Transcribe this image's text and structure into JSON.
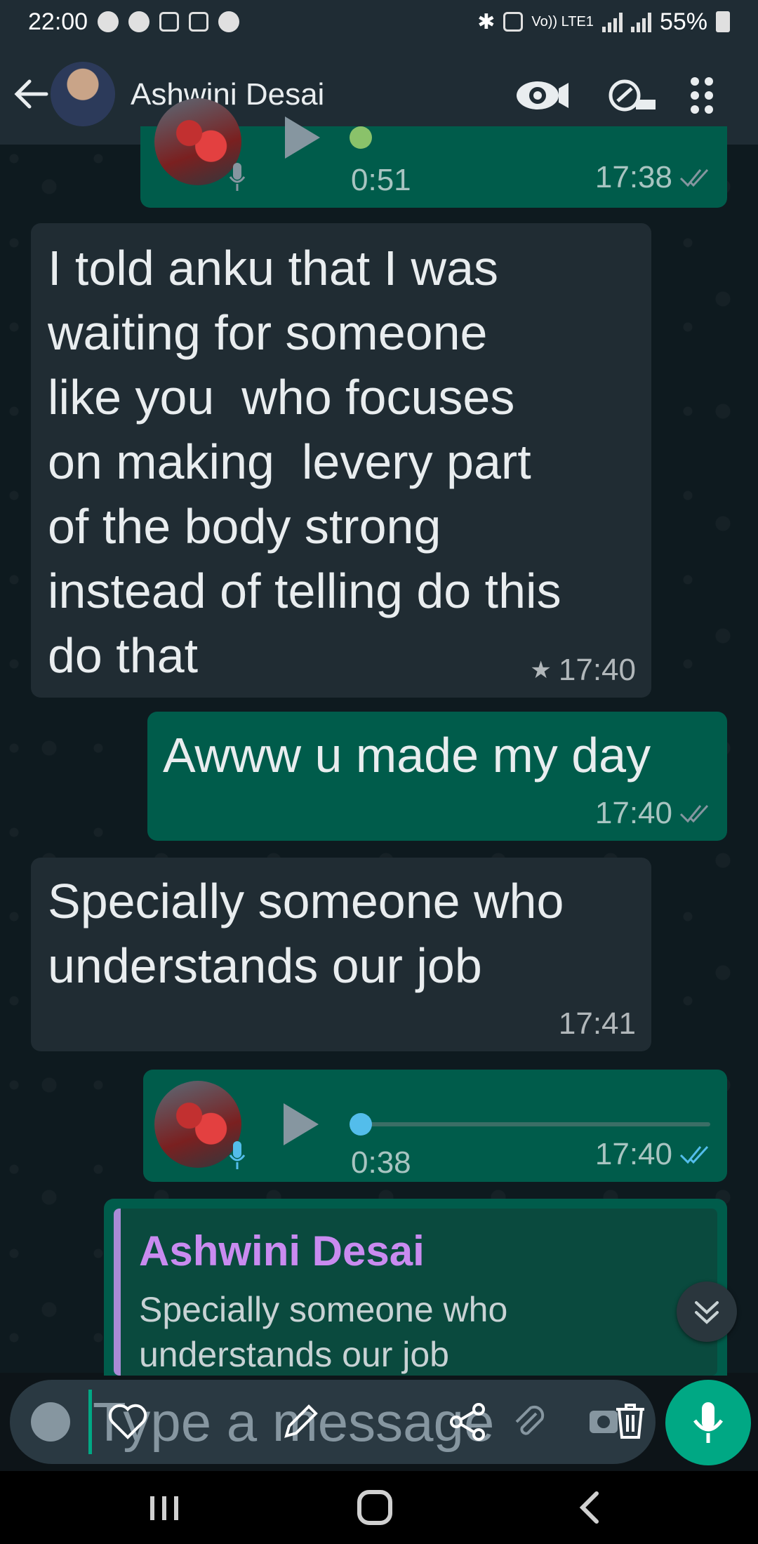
{
  "status_bar": {
    "time": "22:00",
    "battery": "55%",
    "network": "Vo)) LTE1"
  },
  "header": {
    "contact_name": "Ashwini Desai"
  },
  "messages": [
    {
      "type": "voice",
      "direction": "out",
      "duration": "0:51",
      "time": "17:38"
    },
    {
      "type": "text",
      "direction": "in",
      "text": "I told anku that I was\nwaiting for someone\nlike you  who focuses\non making  levery part\nof the body strong\ninstead of telling do this\ndo that",
      "time": "17:40",
      "starred": true
    },
    {
      "type": "text",
      "direction": "out",
      "text": "Awww u made my day",
      "time": "17:40"
    },
    {
      "type": "text",
      "direction": "in",
      "text": "Specially someone who\nunderstands our job",
      "time": "17:41"
    },
    {
      "type": "voice",
      "direction": "out",
      "duration": "0:38",
      "time": "17:40",
      "read": true
    },
    {
      "type": "reply",
      "direction": "out",
      "quoted_name": "Ashwini Desai",
      "quoted_text": "Specially someone who\nunderstands our job"
    }
  ],
  "input": {
    "placeholder": "Type a message"
  },
  "colors": {
    "header_bg": "#1f2c34",
    "incoming_bubble": "#202c33",
    "outgoing_bubble": "#005c4b",
    "accent_green": "#00a884",
    "read_tick_blue": "#53bdeb",
    "quote_name": "#c98bf0"
  },
  "icons": {
    "header": [
      "back-arrow-icon",
      "eye-icon",
      "call-rotate-icon",
      "more-vert-icon"
    ],
    "input": [
      "emoji-icon",
      "heart-icon",
      "pencil-icon",
      "share-icon",
      "attach-icon",
      "camera-icon",
      "trash-icon",
      "mic-icon"
    ],
    "nav": [
      "recents-icon",
      "home-icon",
      "back-icon"
    ]
  }
}
